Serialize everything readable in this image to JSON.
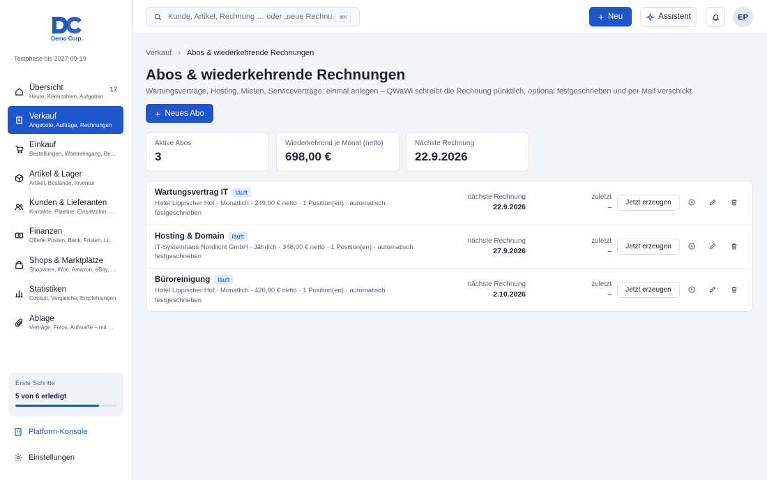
{
  "brand": {
    "logo_letters": "DC",
    "logo_text": "Demo Corp.",
    "trial": "Testphase bis 2027-09-19",
    "color": "#1f56c9"
  },
  "sidebar": {
    "items": [
      {
        "label": "Übersicht",
        "sub": "Heute, Kennzahlen, Aufgaben",
        "badge": "17",
        "icon": "home-icon",
        "active": false
      },
      {
        "label": "Verkauf",
        "sub": "Angebote, Aufträge, Rechnungen",
        "icon": "receipt-icon",
        "active": true
      },
      {
        "label": "Einkauf",
        "sub": "Bestellungen, Wareneingang, Belege",
        "icon": "cart-icon",
        "active": false
      },
      {
        "label": "Artikel & Lager",
        "sub": "Artikel, Bestände, Inventur",
        "icon": "box-icon",
        "active": false
      },
      {
        "label": "Kunden & Lieferanten",
        "sub": "Kontakte, Pipeline, Einsatzplan, Lieferanten",
        "icon": "users-icon",
        "active": false
      },
      {
        "label": "Finanzen",
        "sub": "Offene Posten, Bank, Fristen, Lizenzen",
        "icon": "money-icon",
        "active": false
      },
      {
        "label": "Shops & Marktplätze",
        "sub": "Shopware, Woo, Amazon, eBay, Etsy",
        "icon": "shop-icon",
        "active": false
      },
      {
        "label": "Statistiken",
        "sub": "Cockpit, Vergleiche, Empfehlungen",
        "icon": "chart-icon",
        "active": false
      },
      {
        "label": "Ablage",
        "sub": "Verträge, Fotos, Aufmaße – mit Suche",
        "icon": "paperclip-icon",
        "active": false
      }
    ],
    "steps": {
      "title": "Erste Schritte",
      "count": "5 von 6 erledigt",
      "progress": 0.83
    },
    "console_label": "Platform-Konsole",
    "settings_label": "Einstellungen"
  },
  "topbar": {
    "search_placeholder": "Kunde, Artikel, Rechnung … oder „neue Rechnung“",
    "search_shortcut": "⌘K",
    "new_label": "Neu",
    "assistant_label": "Assistent",
    "avatar_initials": "EP"
  },
  "page": {
    "breadcrumb_parent": "Verkauf",
    "breadcrumb_current": "Abos & wiederkehrende Rechnungen",
    "title": "Abos & wiederkehrende Rechnungen",
    "description": "Wartungsverträge, Hosting, Mieten, Serviceverträge: einmal anlegen – QWaWi schreibt die Rechnung pünktlich, optional festgeschrieben und per Mail verschickt.",
    "new_abo_label": "Neues Abo"
  },
  "kpis": [
    {
      "label": "Aktive Abos",
      "value": "3"
    },
    {
      "label": "Wiederkehrend je Monat (netto)",
      "value": "698,00 €"
    },
    {
      "label": "Nächste Rechnung",
      "value": "22.9.2026"
    }
  ],
  "subscriptions": [
    {
      "name": "Wartungsvertrag IT",
      "status": "läuft",
      "desc": "Hotel Lippischer Hof · Monatlich · 249,00 € netto · 1 Position(en) · automatisch festgeschrieben",
      "next_label": "nächste Rechnung",
      "next_date": "22.9.2026",
      "last_label": "zuletzt",
      "last_value": "–",
      "action_label": "Jetzt erzeugen"
    },
    {
      "name": "Hosting & Domain",
      "status": "läuft",
      "desc": "IT-Systemhaus Nordlicht GmbH · Jährlich · 348,00 € netto · 1 Position(en) · automatisch festgeschrieben",
      "next_label": "nächste Rechnung",
      "next_date": "27.9.2026",
      "last_label": "zuletzt",
      "last_value": "–",
      "action_label": "Jetzt erzeugen"
    },
    {
      "name": "Büroreinigung",
      "status": "läuft",
      "desc": "Hotel Lippischer Hof · Monatlich · 420,00 € netto · 1 Position(en) · automatisch festgeschrieben",
      "next_label": "nächste Rechnung",
      "next_date": "2.10.2026",
      "last_label": "zuletzt",
      "last_value": "–",
      "action_label": "Jetzt erzeugen"
    }
  ]
}
